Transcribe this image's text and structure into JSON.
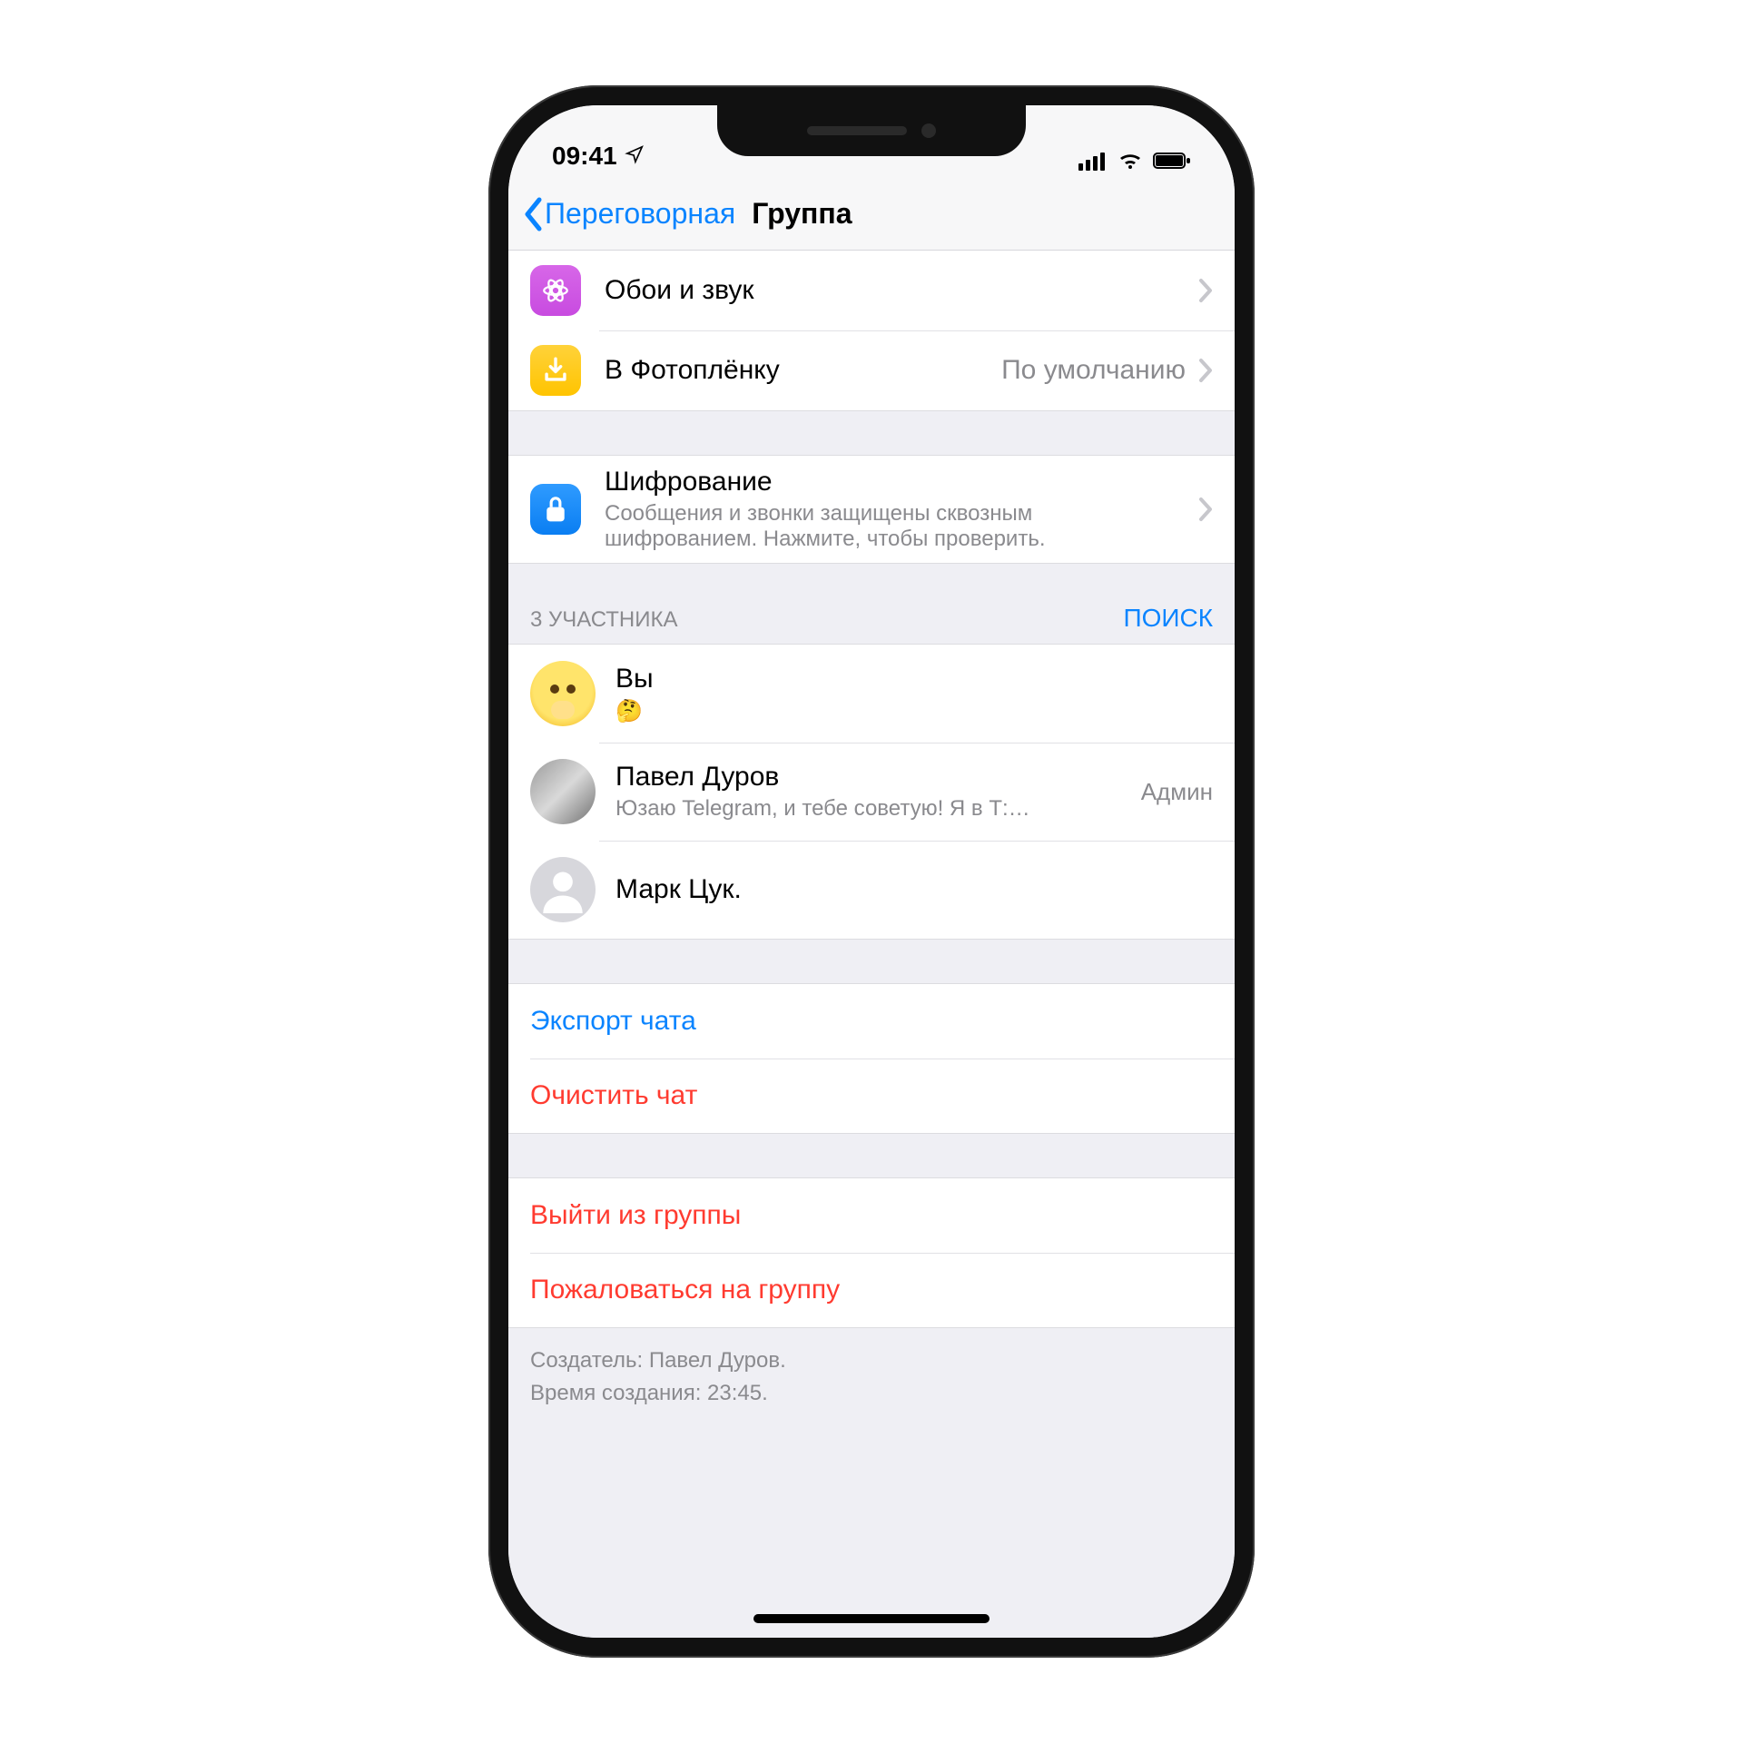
{
  "status": {
    "time": "09:41"
  },
  "nav": {
    "back_label": "Переговорная",
    "title": "Группа"
  },
  "rows": {
    "wallpaper": {
      "title": "Обои и звук"
    },
    "camera_roll": {
      "title": "В Фотоплёнку",
      "value": "По умолчанию"
    },
    "encryption": {
      "title": "Шифрование",
      "sub": "Сообщения и звонки защищены сквозным шифрованием. Нажмите, чтобы проверить."
    }
  },
  "participants_header": {
    "left": "3 УЧАСТНИКА",
    "right": "ПОИСК"
  },
  "participants": [
    {
      "name": "Вы",
      "sub": "🤔",
      "badge": ""
    },
    {
      "name": "Павел Дуров",
      "sub": "Юзаю Telegram, и тебе советую! Я в Т:…",
      "badge": "Админ"
    },
    {
      "name": "Марк Цук.",
      "sub": "",
      "badge": ""
    }
  ],
  "actions": {
    "export": "Экспорт чата",
    "clear": "Очистить чат",
    "leave": "Выйти из группы",
    "report": "Пожаловаться на группу"
  },
  "footer": {
    "line1": "Создатель: Павел Дуров.",
    "line2": "Время создания: 23:45."
  }
}
